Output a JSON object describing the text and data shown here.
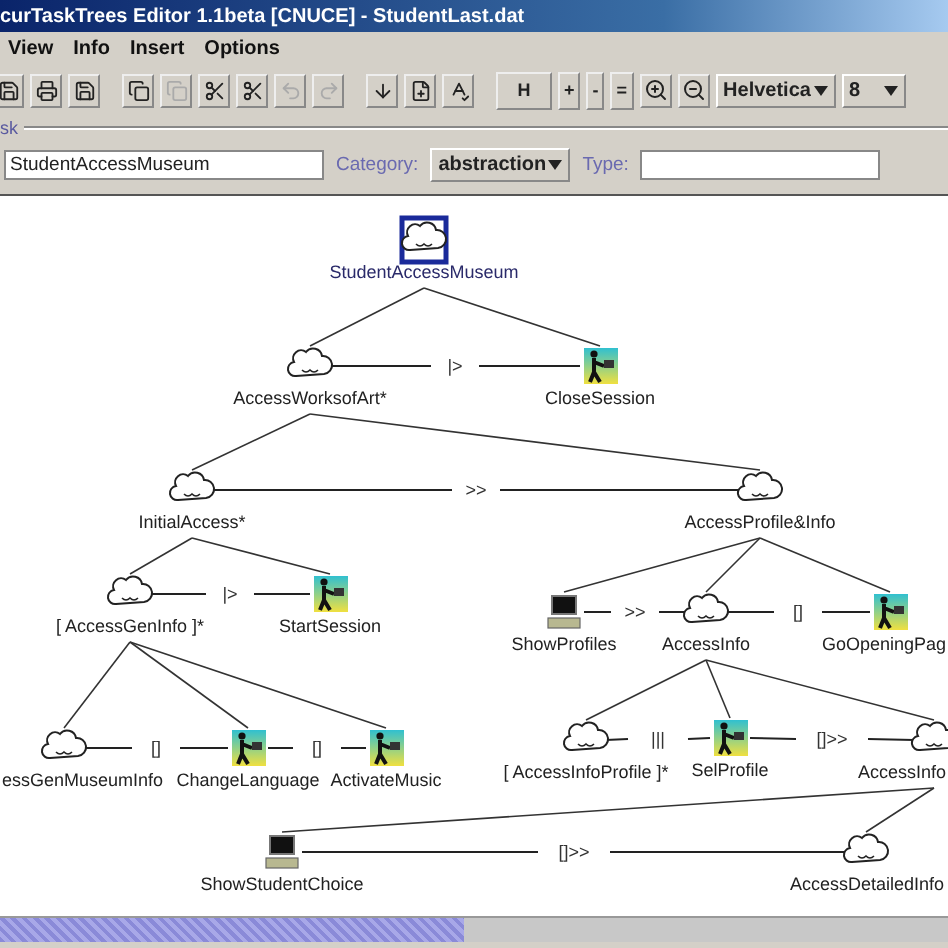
{
  "window": {
    "title": "curTaskTrees Editor 1.1beta [CNUCE] - StudentLast.dat"
  },
  "menu": [
    "View",
    "Info",
    "Insert",
    "Options"
  ],
  "toolbar": {
    "icon_buttons": [
      {
        "disabled": false
      },
      {
        "disabled": false
      },
      {
        "disabled": false
      },
      {
        "disabled": false
      },
      {
        "disabled": true
      },
      {
        "disabled": false
      },
      {
        "disabled": false
      },
      {
        "disabled": true
      },
      {
        "disabled": true
      },
      {
        "disabled": false
      },
      {
        "disabled": false
      },
      {
        "disabled": false
      }
    ],
    "text_buttons": [
      "H",
      "+",
      "-",
      "="
    ],
    "font": "Helvetica",
    "size": "8"
  },
  "task": {
    "legend": "sk",
    "name": "StudentAccessMuseum",
    "category_label": "Category:",
    "category": "abstraction",
    "type_label": "Type:"
  },
  "tree": {
    "name": "StudentAccessMuseum",
    "kind": "abstraction",
    "selected": true,
    "children": [
      {
        "name": "AccessWorksofArt*",
        "kind": "abstraction",
        "selected": false,
        "operator": "|>",
        "children": [
          {
            "name": "InitialAccess*",
            "kind": "abstraction",
            "selected": false,
            "operator": ">>",
            "children": [
              {
                "name": "[ AccessGenInfo ]*",
                "kind": "abstraction",
                "selected": false,
                "operator": "|>",
                "children": [
                  {
                    "name": "essGenMuseumInfo",
                    "kind": "abstraction",
                    "selected": false,
                    "operator": "[]"
                  },
                  {
                    "name": "ChangeLanguage",
                    "kind": "interaction",
                    "selected": false,
                    "operator": "[]"
                  },
                  {
                    "name": "ActivateMusic",
                    "kind": "interaction",
                    "selected": false
                  }
                ]
              },
              {
                "name": "StartSession",
                "kind": "interaction",
                "selected": false
              }
            ]
          },
          {
            "name": "AccessProfile&Info",
            "kind": "abstraction",
            "selected": false,
            "children": [
              {
                "name": "ShowProfiles",
                "kind": "application",
                "selected": false,
                "operator": ">>"
              },
              {
                "name": "AccessInfo",
                "kind": "abstraction",
                "selected": false,
                "operator": "[]",
                "children": [
                  {
                    "name": "[ AccessInfoProfile ]*",
                    "kind": "abstraction",
                    "selected": false,
                    "operator": "|||"
                  },
                  {
                    "name": "SelProfile",
                    "kind": "interaction",
                    "selected": false,
                    "operator": "[]>>"
                  },
                  {
                    "name": "AccessInfo",
                    "kind": "abstraction",
                    "selected": false,
                    "children": [
                      {
                        "name": "ShowStudentChoice",
                        "kind": "application",
                        "selected": false,
                        "operator": "[]>>"
                      },
                      {
                        "name": "AccessDetailedInfo",
                        "kind": "abstraction",
                        "selected": false
                      }
                    ]
                  }
                ]
              },
              {
                "name": "GoOpeningPag",
                "kind": "interaction",
                "selected": false
              }
            ]
          }
        ]
      },
      {
        "name": "CloseSession",
        "kind": "interaction",
        "selected": false
      }
    ]
  }
}
